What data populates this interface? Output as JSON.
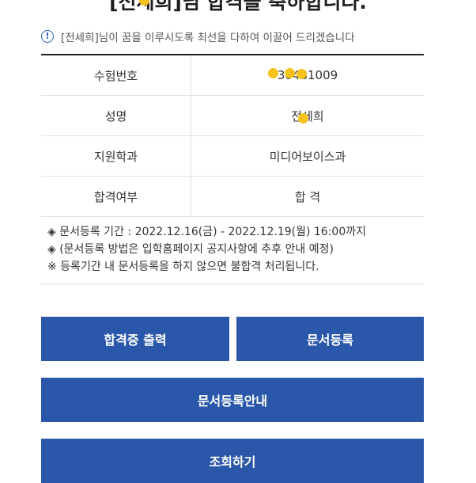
{
  "page_title": "[전세희]님 합격을 축하합니다.",
  "notice": "[전세희]님이 꿈을 이루시도록 최선을 다하여 이끌어 드리겠습니다",
  "result_table": [
    {
      "label": "수험번호",
      "value": "30481009"
    },
    {
      "label": "성명",
      "value": "전세희"
    },
    {
      "label": "지원학과",
      "value": "미디어보이스과"
    },
    {
      "label": "합격여부",
      "value": "합 격"
    }
  ],
  "notes": [
    "◈ 문서등록 기간 : 2022.12.16(금) - 2022.12.19(월) 16:00까지",
    "◈ (문서등록 방법은 입학홈페이지 공지사항에 추후 안내 예정)",
    "※ 등록기간 내 문서등록을 하지 않으면 불합격 처리됩니다."
  ],
  "buttons": {
    "print_certificate": "합격증 출력",
    "document_register": "문서등록",
    "document_guide": "문서등록안내",
    "lookup": "조회하기"
  },
  "colors": {
    "button_bg": "#2a57a9",
    "info_icon": "#2f5db5",
    "redaction_dot": "#f7c21b"
  }
}
